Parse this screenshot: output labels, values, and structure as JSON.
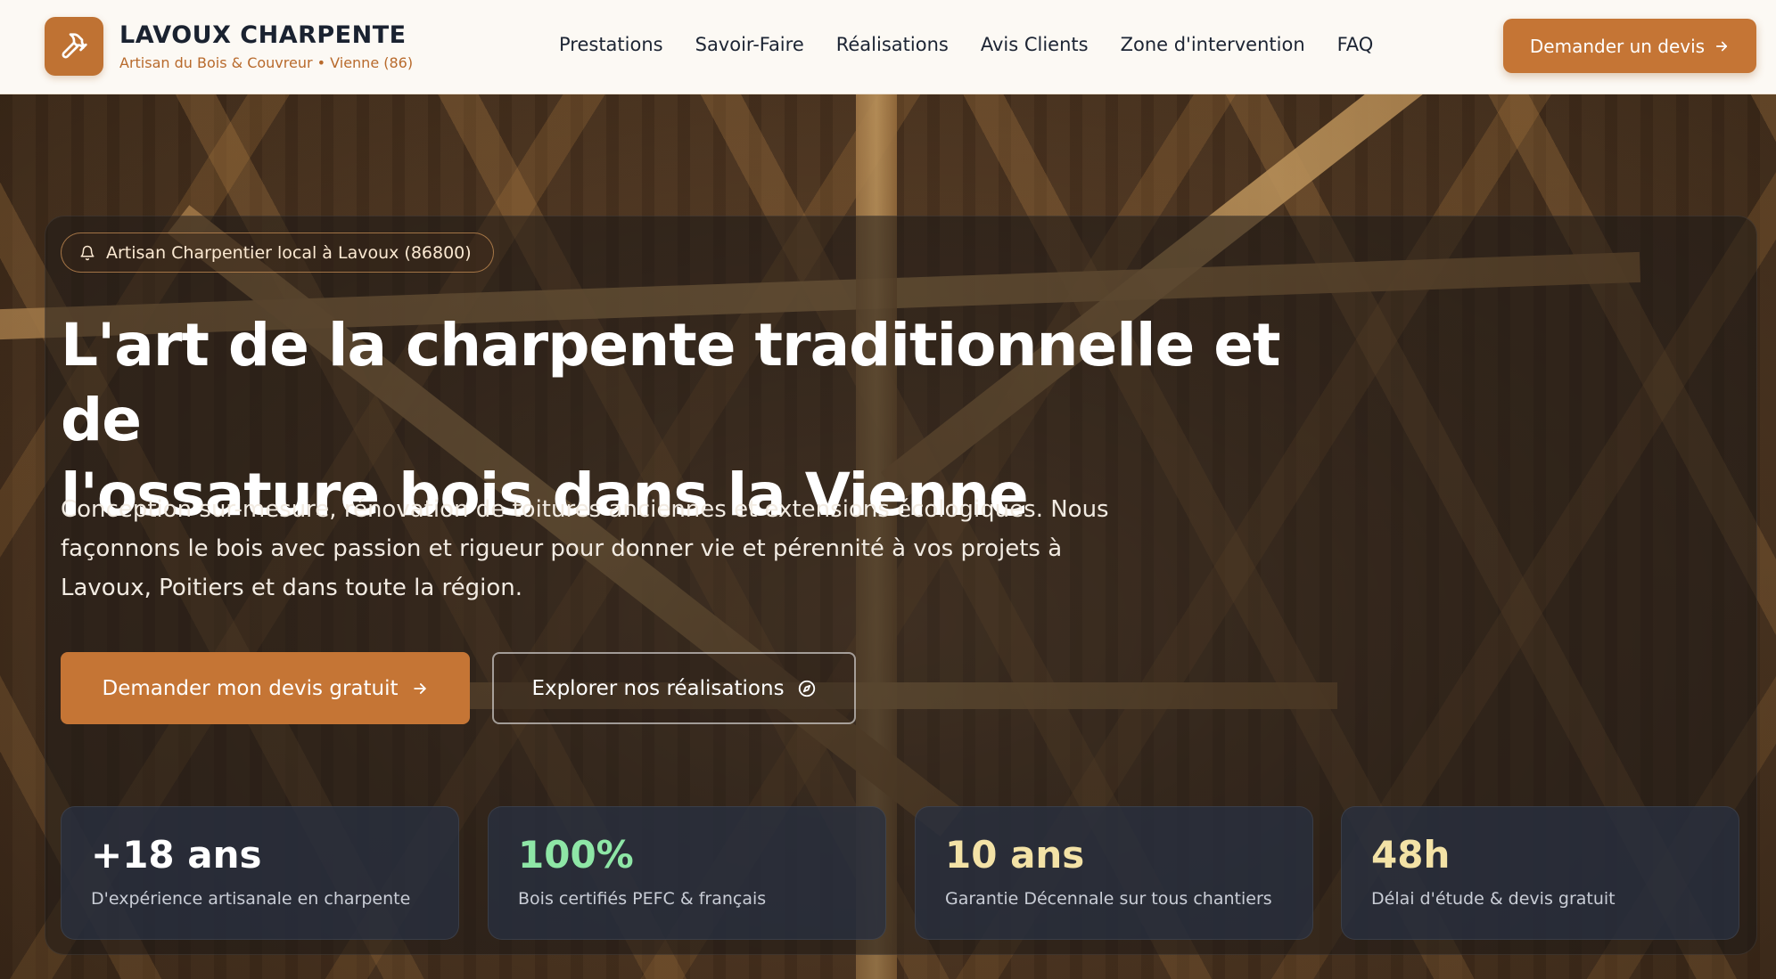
{
  "brand": {
    "name": "LAVOUX CHARPENTE",
    "tagline": "Artisan du Bois & Couvreur • Vienne (86)",
    "icon": "hammer-icon"
  },
  "nav": {
    "items": [
      {
        "label": "Prestations"
      },
      {
        "label": "Savoir-Faire"
      },
      {
        "label": "Réalisations"
      },
      {
        "label": "Avis Clients"
      },
      {
        "label": "Zone d'intervention"
      },
      {
        "label": "FAQ"
      }
    ]
  },
  "header_cta": {
    "label": "Demander un devis",
    "icon": "arrow-right-icon"
  },
  "hero": {
    "badge": "Artisan Charpentier local à Lavoux (86800)",
    "badge_icon": "bell-icon",
    "title_line1": "L'art de la charpente traditionnelle et de",
    "title_line2": "l'ossature bois dans la Vienne",
    "description": "Conception sur-mesure, rénovation de toitures anciennes et extensions écologiques. Nous façonnons le bois avec passion et rigueur pour donner vie et pérennité à vos projets à Lavoux, Poitiers et dans toute la région.",
    "primary_button": "Demander mon devis gratuit",
    "secondary_button": "Explorer nos réalisations",
    "secondary_icon": "compass-icon"
  },
  "stats": [
    {
      "value": "+18 ans",
      "label": "D'expérience artisanale en charpente",
      "color": "#ffffff"
    },
    {
      "value": "100%",
      "label": "Bois certifiés PEFC & français",
      "color": "#8ee6a6"
    },
    {
      "value": "10 ans",
      "label": "Garantie Décennale sur tous chantiers",
      "color": "#f3e2a6"
    },
    {
      "value": "48h",
      "label": "Délai d'étude & devis gratuit",
      "color": "#f3e2a6"
    }
  ],
  "colors": {
    "accent": "#c57535",
    "brand_sub": "#b86a2c",
    "header_bg": "#fcf9f4"
  }
}
